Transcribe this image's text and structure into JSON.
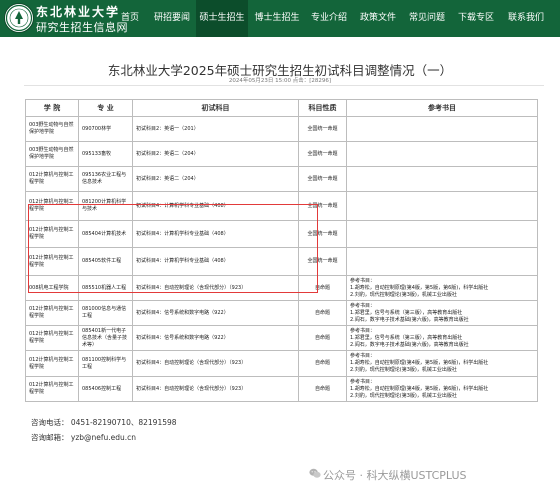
{
  "header": {
    "brand_line1": "东北林业大学",
    "brand_line2": "研究生招生信息网"
  },
  "nav": {
    "items": [
      {
        "label": "首页"
      },
      {
        "label": "研招要闻"
      },
      {
        "label": "硕士生招生",
        "active": true
      },
      {
        "label": "博士生招生"
      },
      {
        "label": "专业介绍"
      },
      {
        "label": "政策文件"
      },
      {
        "label": "常见问题"
      },
      {
        "label": "下载专区"
      },
      {
        "label": "联系我们"
      }
    ]
  },
  "article": {
    "title": "东北林业大学2025年硕士研究生招生初试科目调整情况（一）",
    "meta": "2024年05月23日 15:00  点击：[28296]"
  },
  "table": {
    "headers": [
      "学 院",
      "专 业",
      "初试科目",
      "科目性质",
      "参考书目"
    ],
    "rows": [
      {
        "college": "003野生动物与自然保护地学院",
        "major": "090700林学",
        "subject": "初试科目2：英语一（201）",
        "nature": "全国统一命题",
        "ref": ""
      },
      {
        "college": "003野生动物与自然保护地学院",
        "major": "095133畜牧",
        "subject": "初试科目2：英语二（204）",
        "nature": "全国统一命题",
        "ref": ""
      },
      {
        "college": "012计算机与控制工程学院",
        "major": "095136农业工程与信息技术",
        "subject": "初试科目2：英语二（204）",
        "nature": "全国统一命题",
        "ref": ""
      },
      {
        "college": "012计算机与控制工程学院",
        "major": "081200计算机科学与技术",
        "subject": "初试科目4：计算机学科专业基础（408）",
        "nature": "全国统一命题",
        "ref": ""
      },
      {
        "college": "012计算机与控制工程学院",
        "major": "085404计算机技术",
        "subject": "初试科目4：计算机学科专业基础（408）",
        "nature": "全国统一命题",
        "ref": ""
      },
      {
        "college": "012计算机与控制工程学院",
        "major": "085405软件工程",
        "subject": "初试科目4：计算机学科专业基础（408）",
        "nature": "全国统一命题",
        "ref": ""
      },
      {
        "college": "008机电工程学院",
        "major": "085510机器人工程",
        "subject": "初试科目4：自动控制理论（含现代部分）（923）",
        "nature": "自命题",
        "ref": "参考书目：\n1.胡寿松，自动控制原理(第4版，第5版，第6版)，科学出版社\n2.刘豹，现代控制理论(第3版)，机械工业出版社"
      },
      {
        "college": "012计算机与控制工程学院",
        "major": "081000信息与通信工程",
        "subject": "初试科目4：信号系统和数字电路（922）",
        "nature": "自命题",
        "ref": "参考书目：\n1.郑君里，信号与系统（第三版），高等教育出版社\n2.阎石，数字电子技术基础(第六版)，高等教育出版社"
      },
      {
        "college": "012计算机与控制工程学院",
        "major": "085401新一代电子信息技术（含量子技术等）",
        "subject": "初试科目4：信号系统和数字电路（922）",
        "nature": "自命题",
        "ref": "参考书目：\n1.郑君里，信号与系统（第三版），高等教育出版社\n2.阎石，数字电子技术基础(第六版)，高等教育出版社"
      },
      {
        "college": "012计算机与控制工程学院",
        "major": "081100控制科学与工程",
        "subject": "初试科目4：自动控制理论（含现代部分）（923）",
        "nature": "自命题",
        "ref": "参考书目：\n1.胡寿松，自动控制原理(第4版，第5版，第6版)，科学出版社\n2.刘豹，现代控制理论(第3版)，机械工业出版社"
      },
      {
        "college": "012计算机与控制工程学院",
        "major": "085406控制工程",
        "subject": "初试科目4：自动控制理论（含现代部分）（923）",
        "nature": "自命题",
        "ref": "参考书目：\n1.胡寿松，自动控制原理(第4版，第5版，第6版)，科学出版社\n2.刘豹，现代控制理论(第3版)，机械工业出版社"
      }
    ]
  },
  "contact": {
    "phone": "咨询电话：  0451-82190710、82191598",
    "email": "咨询邮箱：  yzb@nefu.edu.cn"
  },
  "watermark": {
    "text": "公众号 · 科大纵横USTCPLUS"
  }
}
